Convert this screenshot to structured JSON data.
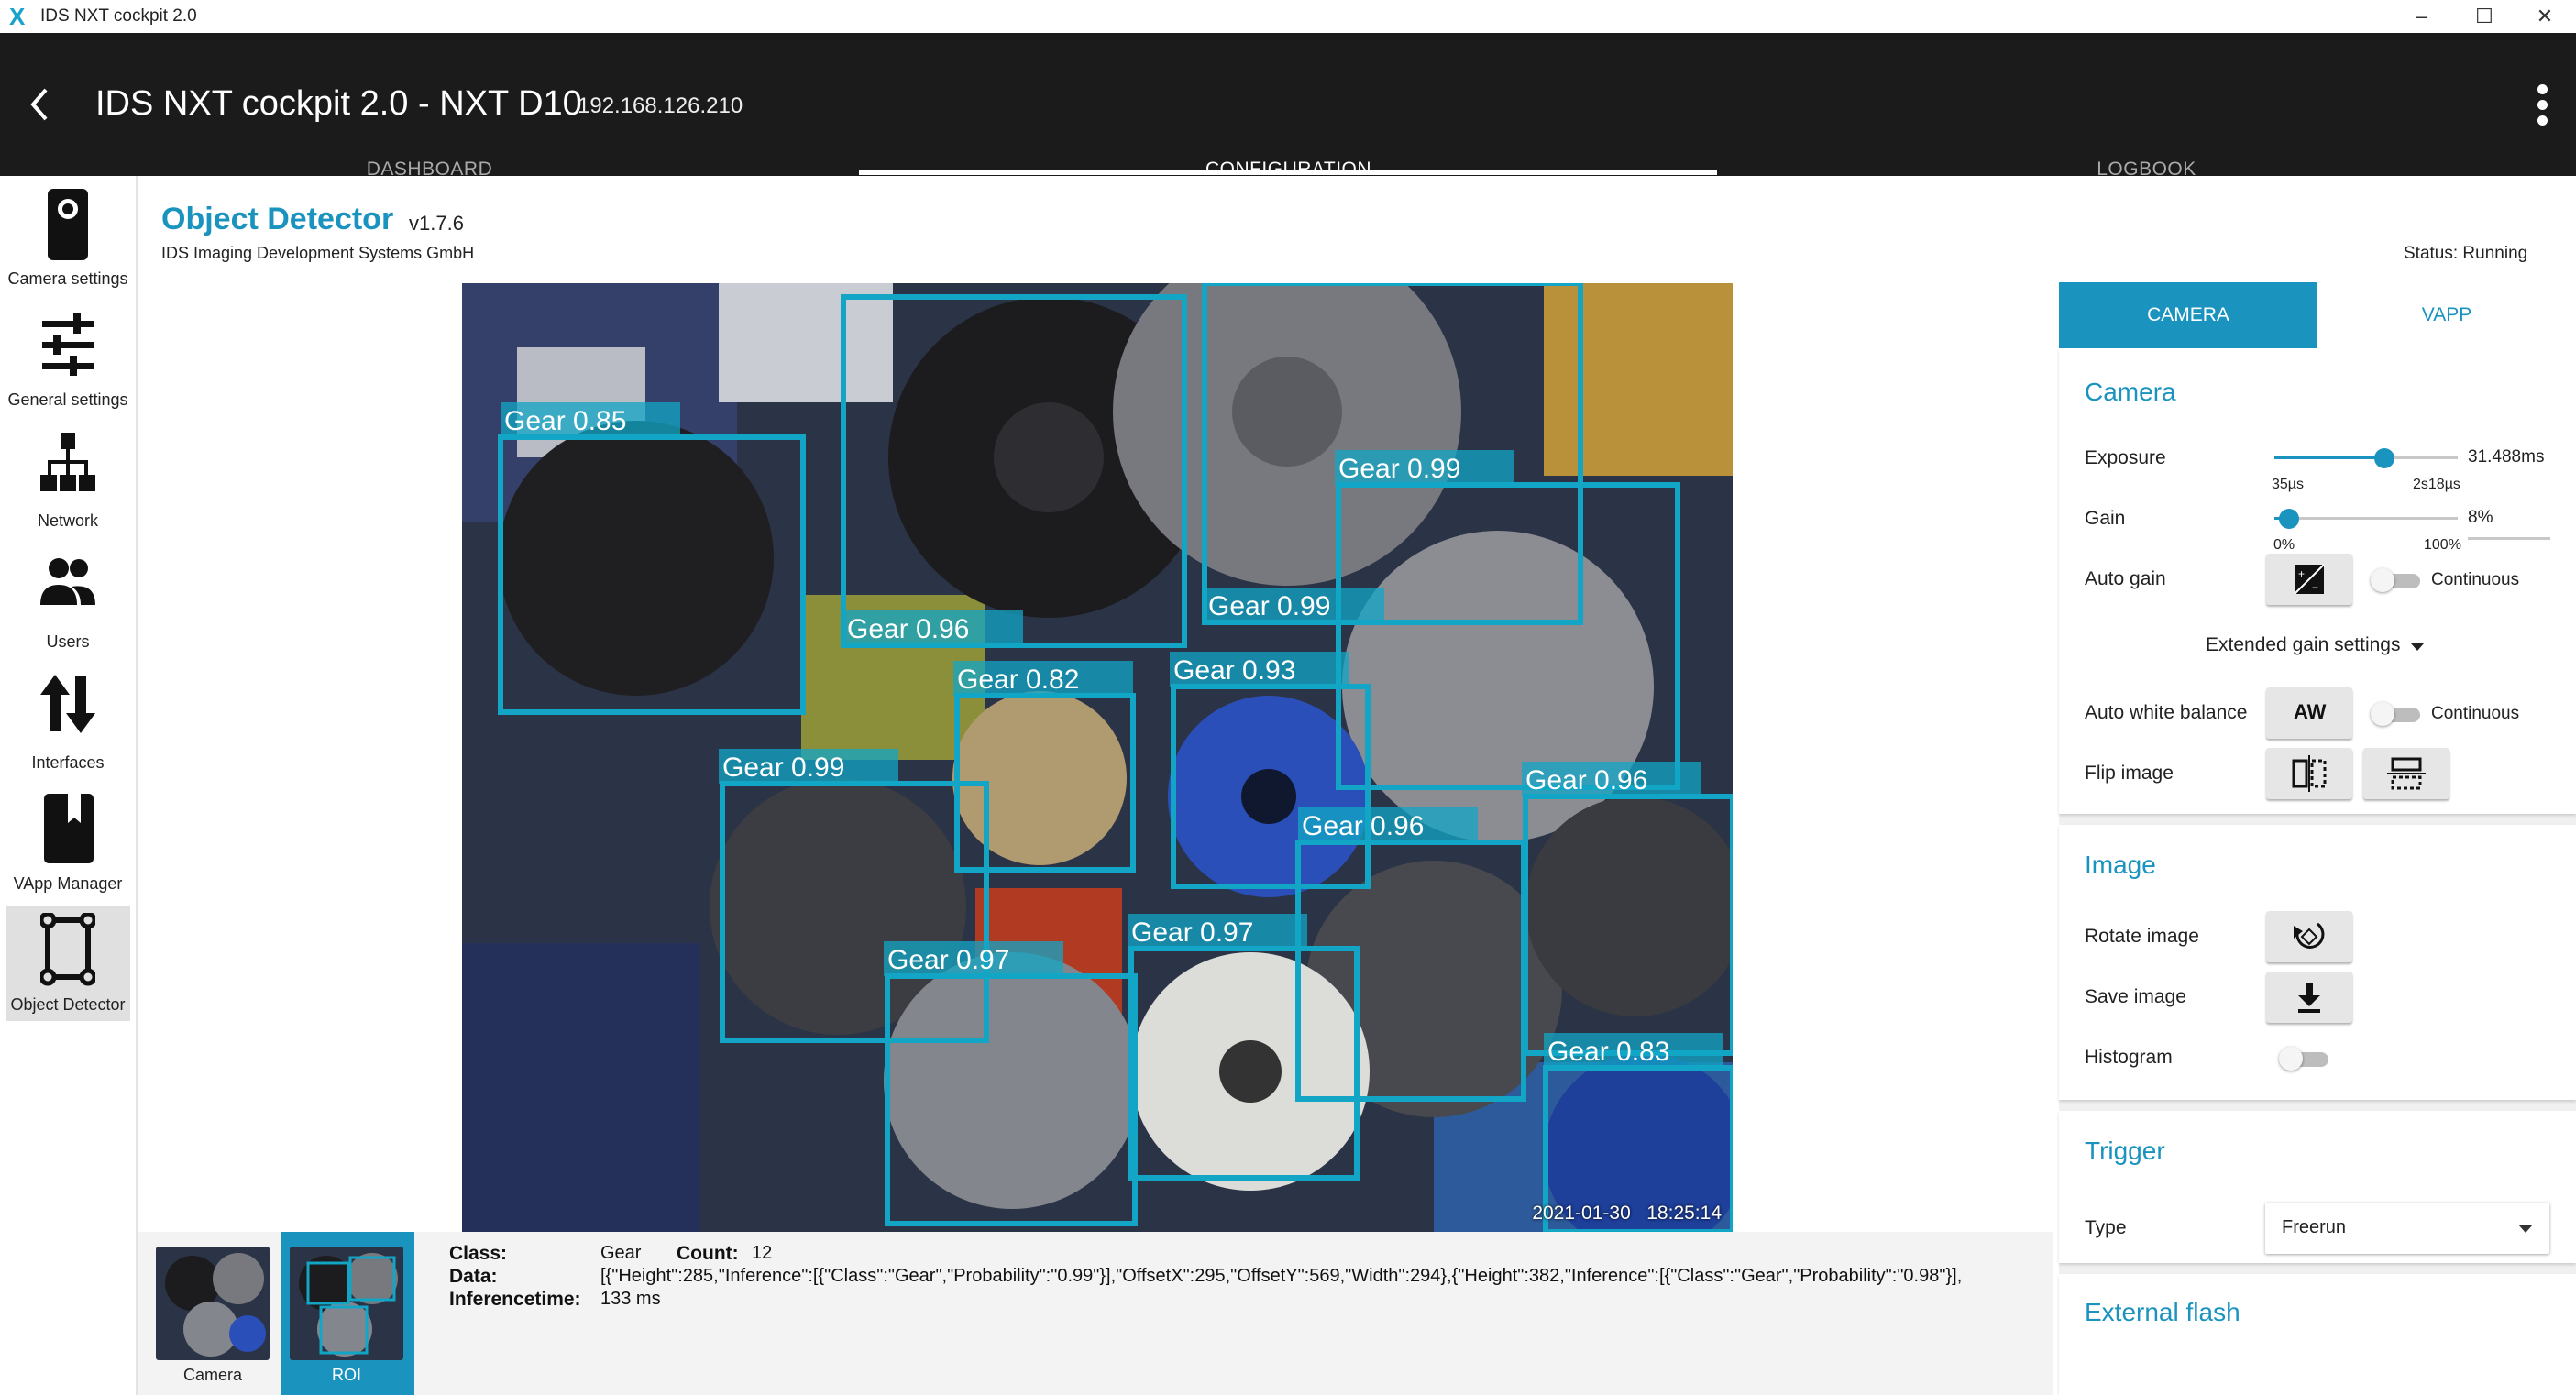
{
  "window": {
    "title": "IDS NXT cockpit 2.0"
  },
  "appbar": {
    "title": "IDS NXT cockpit 2.0 - NXT D10",
    "ip": "192.168.126.210"
  },
  "tabs": [
    {
      "label": "DASHBOARD"
    },
    {
      "label": "CONFIGURATION"
    },
    {
      "label": "LOGBOOK"
    }
  ],
  "sidebar": {
    "items": [
      {
        "label": "Camera settings",
        "icon": "camera-icon"
      },
      {
        "label": "General settings",
        "icon": "sliders-icon"
      },
      {
        "label": "Network",
        "icon": "network-icon"
      },
      {
        "label": "Users",
        "icon": "users-icon"
      },
      {
        "label": "Interfaces",
        "icon": "arrows-updown-icon"
      },
      {
        "label": "VApp Manager",
        "icon": "book-icon"
      },
      {
        "label": "Object Detector",
        "icon": "roi-frame-icon"
      }
    ]
  },
  "app": {
    "name": "Object Detector",
    "version": "v1.7.6",
    "vendor": "IDS Imaging Development Systems GmbH",
    "status": "Status: Running"
  },
  "camera_view": {
    "timestamp": "2021-01-30   18:25:14",
    "detections": [
      {
        "label": "Gear 0.85"
      },
      {
        "label": "Gear 0.96"
      },
      {
        "label": "Gear 0.99"
      },
      {
        "label": "Gear 0.99"
      },
      {
        "label": "Gear 0.82"
      },
      {
        "label": "Gear 0.93"
      },
      {
        "label": "Gear 0.99"
      },
      {
        "label": "Gear 0.96"
      },
      {
        "label": "Gear 0.96"
      },
      {
        "label": "Gear 0.97"
      },
      {
        "label": "Gear 0.97"
      },
      {
        "label": "Gear 0.83"
      }
    ]
  },
  "bottom": {
    "thumbs": [
      {
        "label": "Camera"
      },
      {
        "label": "ROI"
      }
    ],
    "class_key": "Class:",
    "class_val": "Gear",
    "count_key": "Count:",
    "count_val": "12",
    "data_key": "Data:",
    "data_val": "[{\"Height\":285,\"Inference\":[{\"Class\":\"Gear\",\"Probability\":\"0.99\"}],\"OffsetX\":295,\"OffsetY\":569,\"Width\":294},{\"Height\":382,\"Inference\":[{\"Class\":\"Gear\",\"Probability\":\"0.98\"}],",
    "time_key": "Inferencetime:",
    "time_val": "133 ms"
  },
  "rpanel": {
    "tabs": [
      {
        "label": "CAMERA"
      },
      {
        "label": "VAPP"
      }
    ],
    "camera": {
      "title": "Camera",
      "exposure": {
        "label": "Exposure",
        "value": "31.488ms",
        "min": "35µs",
        "max": "2s18µs",
        "level": 0.6
      },
      "gain": {
        "label": "Gain",
        "value": "8%",
        "min": "0%",
        "max": "100%",
        "level": 0.08
      },
      "auto_gain": {
        "label": "Auto gain",
        "toggle": "Continuous"
      },
      "extended": "Extended gain settings",
      "auto_wb": {
        "label": "Auto white balance",
        "button": "AW",
        "toggle": "Continuous"
      },
      "flip": {
        "label": "Flip image"
      }
    },
    "image": {
      "title": "Image",
      "rotate": "Rotate image",
      "save": "Save image",
      "histogram": "Histogram"
    },
    "trigger": {
      "title": "Trigger",
      "type_label": "Type",
      "type_value": "Freerun"
    },
    "flash": {
      "title": "External flash"
    }
  }
}
